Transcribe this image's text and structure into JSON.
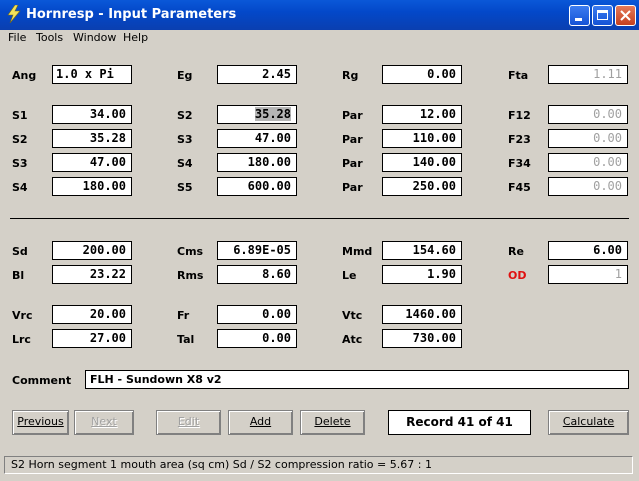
{
  "window": {
    "title": "Hornresp - Input Parameters"
  },
  "menu": [
    "File",
    "Tools",
    "Window",
    "Help"
  ],
  "params": {
    "ang": {
      "label": "Ang",
      "value": "1.0 x Pi"
    },
    "eg": {
      "label": "Eg",
      "value": "2.45"
    },
    "rg": {
      "label": "Rg",
      "value": "0.00"
    },
    "fta": {
      "label": "Fta",
      "value": "1.11"
    },
    "s1": {
      "label": "S1",
      "value": "34.00"
    },
    "s2a": {
      "label": "S2",
      "value": "35.28"
    },
    "s2b": {
      "label": "S2",
      "value": "35.28"
    },
    "s3a": {
      "label": "S3",
      "value": "47.00"
    },
    "s3b": {
      "label": "S3",
      "value": "47.00"
    },
    "s4a": {
      "label": "S4",
      "value": "180.00"
    },
    "s4b": {
      "label": "S4",
      "value": "180.00"
    },
    "s5": {
      "label": "S5",
      "value": "600.00"
    },
    "par1": {
      "label": "Par",
      "value": "12.00"
    },
    "par2": {
      "label": "Par",
      "value": "110.00"
    },
    "par3": {
      "label": "Par",
      "value": "140.00"
    },
    "par4": {
      "label": "Par",
      "value": "250.00"
    },
    "f12": {
      "label": "F12",
      "value": "0.00"
    },
    "f23": {
      "label": "F23",
      "value": "0.00"
    },
    "f34": {
      "label": "F34",
      "value": "0.00"
    },
    "f45": {
      "label": "F45",
      "value": "0.00"
    },
    "sd": {
      "label": "Sd",
      "value": "200.00"
    },
    "bl": {
      "label": "Bl",
      "value": "23.22"
    },
    "cms": {
      "label": "Cms",
      "value": "6.89E-05"
    },
    "rms": {
      "label": "Rms",
      "value": "8.60"
    },
    "mmd": {
      "label": "Mmd",
      "value": "154.60"
    },
    "le": {
      "label": "Le",
      "value": "1.90"
    },
    "re": {
      "label": "Re",
      "value": "6.00"
    },
    "od": {
      "label": "OD",
      "value": "1"
    },
    "vrc": {
      "label": "Vrc",
      "value": "20.00"
    },
    "lrc": {
      "label": "Lrc",
      "value": "27.00"
    },
    "fr": {
      "label": "Fr",
      "value": "0.00"
    },
    "tal": {
      "label": "Tal",
      "value": "0.00"
    },
    "vtc": {
      "label": "Vtc",
      "value": "1460.00"
    },
    "atc": {
      "label": "Atc",
      "value": "730.00"
    }
  },
  "comment": {
    "label": "Comment",
    "value": "FLH - Sundown X8 v2"
  },
  "buttons": {
    "previous": "Previous",
    "next": "Next",
    "edit": "Edit",
    "add": "Add",
    "delete": "Delete",
    "calculate": "Calculate"
  },
  "record": "Record 41 of 41",
  "status": "S2   Horn segment 1 mouth area  (sq cm)   Sd / S2 compression ratio = 5.67 : 1",
  "colors": {
    "titlebar": "#0348c9",
    "od_label": "#e01010",
    "face": "#d4d0c8"
  }
}
